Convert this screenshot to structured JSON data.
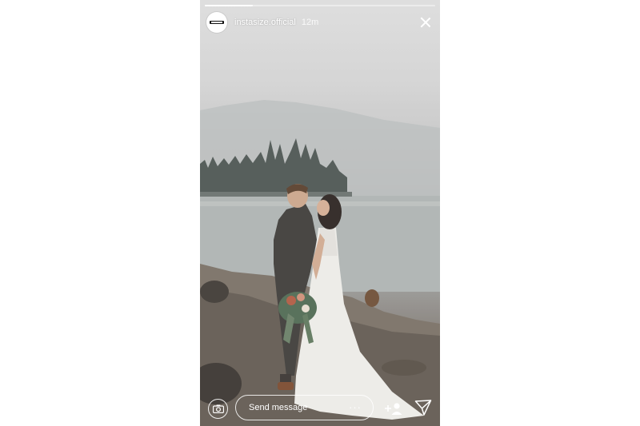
{
  "story": {
    "username": "instasize.official",
    "time": "12m",
    "avatar_text": "Instasize",
    "progress": 0.21
  },
  "footer": {
    "message_placeholder": "Send message",
    "more_label": "···"
  },
  "icons": {
    "close": "close-icon",
    "camera": "camera-icon",
    "add_user": "add-user-icon",
    "share": "paper-plane-icon"
  }
}
